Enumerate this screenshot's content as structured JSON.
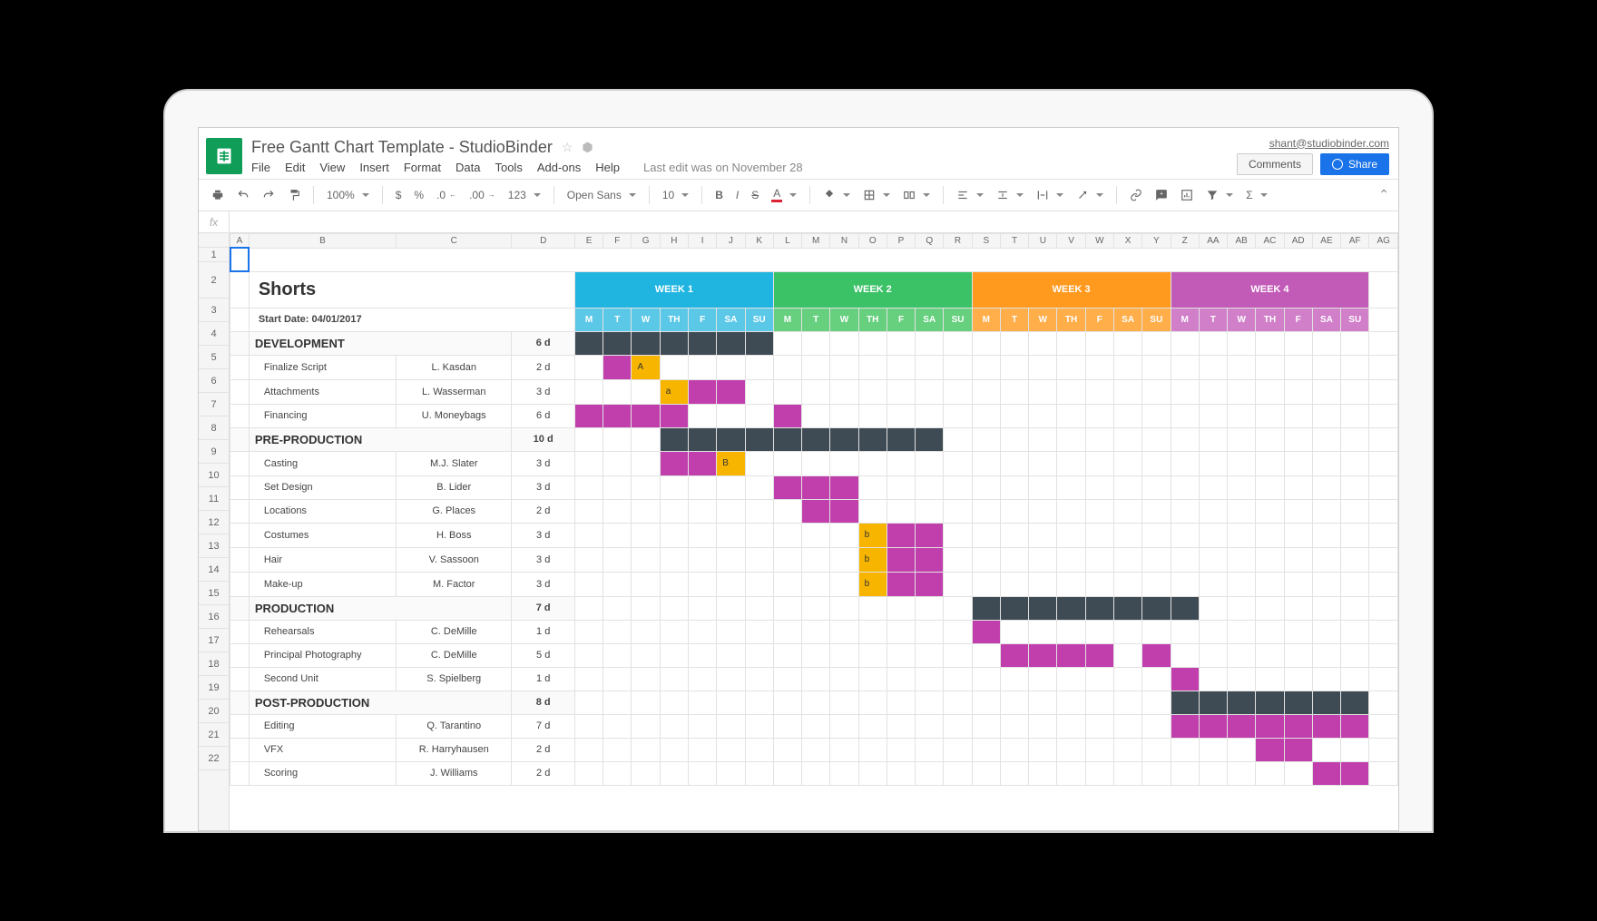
{
  "doc_title": "Free Gantt Chart Template - StudioBinder",
  "account": "shant@studiobinder.com",
  "buttons": {
    "comments": "Comments",
    "share": "Share"
  },
  "menus": [
    "File",
    "Edit",
    "View",
    "Insert",
    "Format",
    "Data",
    "Tools",
    "Add-ons",
    "Help"
  ],
  "last_edit": "Last edit was on November 28",
  "toolbar": {
    "zoom": "100%",
    "currency": "$",
    "percent": "%",
    "dec_dec": ".0",
    "dec_inc": ".00",
    "more_fmt": "123",
    "font": "Open Sans",
    "font_size": "10",
    "bold": "B",
    "italic": "I",
    "strike": "S",
    "color": "A"
  },
  "fx_label": "fx",
  "col_letters": [
    "A",
    "B",
    "C",
    "D",
    "E",
    "F",
    "G",
    "H",
    "I",
    "J",
    "K",
    "L",
    "M",
    "N",
    "O",
    "P",
    "Q",
    "R",
    "S",
    "T",
    "U",
    "V",
    "W",
    "X",
    "Y",
    "Z",
    "AA",
    "AB",
    "AC",
    "AD",
    "AE",
    "AF",
    "AG"
  ],
  "sheet_title": "Shorts",
  "start_date_label": "Start Date: 04/01/2017",
  "weeks": [
    "WEEK 1",
    "WEEK 2",
    "WEEK 3",
    "WEEK 4"
  ],
  "day_labels": [
    "M",
    "T",
    "W",
    "TH",
    "F",
    "SA",
    "SU"
  ],
  "sections": {
    "development": {
      "label": "DEVELOPMENT",
      "duration": "6 d"
    },
    "preprod": {
      "label": "PRE-PRODUCTION",
      "duration": "10 d"
    },
    "production": {
      "label": "PRODUCTION",
      "duration": "7 d"
    },
    "postprod": {
      "label": "POST-PRODUCTION",
      "duration": "8 d"
    }
  },
  "tasks": [
    {
      "name": "Finalize Script",
      "owner": "L. Kasdan",
      "dur": "2 d"
    },
    {
      "name": "Attachments",
      "owner": "L. Wasserman",
      "dur": "3 d"
    },
    {
      "name": "Financing",
      "owner": "U. Moneybags",
      "dur": "6 d"
    },
    {
      "name": "Casting",
      "owner": "M.J. Slater",
      "dur": "3 d"
    },
    {
      "name": "Set Design",
      "owner": "B. Lider",
      "dur": "3 d"
    },
    {
      "name": "Locations",
      "owner": "G. Places",
      "dur": "2 d"
    },
    {
      "name": "Costumes",
      "owner": "H. Boss",
      "dur": "3 d"
    },
    {
      "name": "Hair",
      "owner": "V. Sassoon",
      "dur": "3 d"
    },
    {
      "name": "Make-up",
      "owner": "M. Factor",
      "dur": "3 d"
    },
    {
      "name": "Rehearsals",
      "owner": "C. DeMille",
      "dur": "1 d"
    },
    {
      "name": "Principal Photography",
      "owner": "C. DeMille",
      "dur": "5 d"
    },
    {
      "name": "Second Unit",
      "owner": "S. Spielberg",
      "dur": "1 d"
    },
    {
      "name": "Editing",
      "owner": "Q. Tarantino",
      "dur": "7 d"
    },
    {
      "name": "VFX",
      "owner": "R. Harryhausen",
      "dur": "2 d"
    },
    {
      "name": "Scoring",
      "owner": "J. Williams",
      "dur": "2 d"
    }
  ],
  "markers": {
    "A": "A",
    "a": "a",
    "B": "B",
    "b": "b"
  },
  "chart_data": {
    "type": "gantt",
    "unit": "day",
    "day_index_note": "day 1 = WEEK 1 Monday, day 28 = WEEK 4 Sunday",
    "sections": [
      {
        "name": "DEVELOPMENT",
        "start": 1,
        "end": 7
      },
      {
        "name": "PRE-PRODUCTION",
        "start": 4,
        "end": 13
      },
      {
        "name": "PRODUCTION",
        "start": 15,
        "end": 22
      },
      {
        "name": "POST-PRODUCTION",
        "start": 22,
        "end": 28
      }
    ],
    "tasks": [
      {
        "name": "Finalize Script",
        "owner": "L. Kasdan",
        "start": 2,
        "end": 3,
        "marker": "A",
        "marker_day": 3
      },
      {
        "name": "Attachments",
        "owner": "L. Wasserman",
        "start": 4,
        "end": 6,
        "marker": "a",
        "marker_day": 4
      },
      {
        "name": "Financing",
        "owner": "U. Moneybags",
        "start": 1,
        "end": 4,
        "extra_days": [
          8
        ]
      },
      {
        "name": "Casting",
        "owner": "M.J. Slater",
        "start": 4,
        "end": 5,
        "marker": "B",
        "marker_day": 6
      },
      {
        "name": "Set Design",
        "owner": "B. Lider",
        "start": 8,
        "end": 10
      },
      {
        "name": "Locations",
        "owner": "G. Places",
        "start": 9,
        "end": 10
      },
      {
        "name": "Costumes",
        "owner": "H. Boss",
        "start": 12,
        "end": 13,
        "marker": "b",
        "marker_day": 11
      },
      {
        "name": "Hair",
        "owner": "V. Sassoon",
        "start": 12,
        "end": 13,
        "marker": "b",
        "marker_day": 11
      },
      {
        "name": "Make-up",
        "owner": "M. Factor",
        "start": 12,
        "end": 13,
        "marker": "b",
        "marker_day": 11
      },
      {
        "name": "Rehearsals",
        "owner": "C. DeMille",
        "start": 15,
        "end": 15
      },
      {
        "name": "Principal Photography",
        "owner": "C. DeMille",
        "start": 16,
        "end": 21,
        "skip": [
          20
        ]
      },
      {
        "name": "Second Unit",
        "owner": "S. Spielberg",
        "start": 22,
        "end": 22
      },
      {
        "name": "Editing",
        "owner": "Q. Tarantino",
        "start": 22,
        "end": 28
      },
      {
        "name": "VFX",
        "owner": "R. Harryhausen",
        "start": 25,
        "end": 26
      },
      {
        "name": "Scoring",
        "owner": "J. Williams",
        "start": 27,
        "end": 28
      }
    ]
  }
}
